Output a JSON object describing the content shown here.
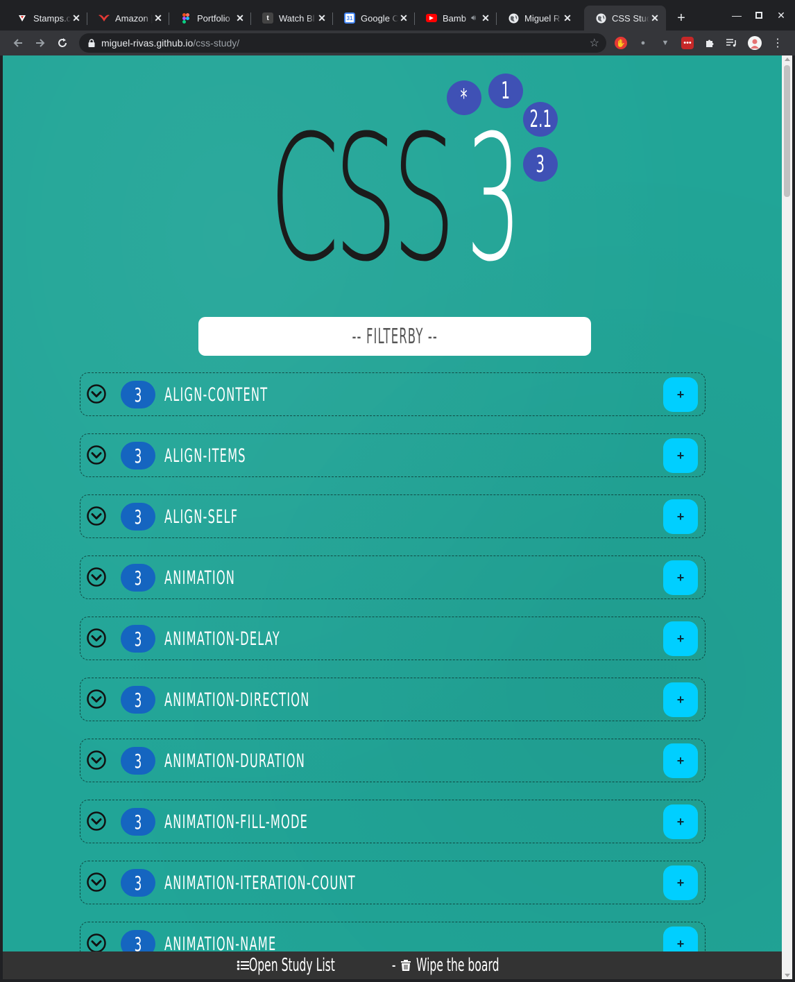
{
  "browser": {
    "tabs": [
      {
        "title": "Stamps.c",
        "favicon": "stamps-icon",
        "color": "#ffffff"
      },
      {
        "title": "Amazon |",
        "favicon": "amazon-bird-icon",
        "color": "#e53935"
      },
      {
        "title": "Portfolio",
        "favicon": "figma-icon",
        "color": "#f24e1e"
      },
      {
        "title": "Watch Bl",
        "favicon": "tumblr-icon",
        "color": "#444444"
      },
      {
        "title": "Google C",
        "favicon": "calendar-icon",
        "color": "#4285f4"
      },
      {
        "title": "Bamb",
        "favicon": "youtube-icon",
        "color": "#ff0000"
      },
      {
        "title": "Miguel R",
        "favicon": "globe-icon",
        "color": "#9aa0a6"
      },
      {
        "title": "CSS Stud",
        "favicon": "globe-icon",
        "color": "#9aa0a6",
        "active": true
      }
    ],
    "new_tab_label": "+",
    "address": {
      "host": "miguel-rivas.github.io",
      "path": "/css-study/"
    }
  },
  "hero": {
    "title": "CSS",
    "version": "3",
    "version_bubbles": [
      "*",
      "1",
      "2.1",
      "3"
    ]
  },
  "filter": {
    "label": "-- FILTERBY --"
  },
  "properties": [
    {
      "version": "3",
      "name": "ALIGN-CONTENT"
    },
    {
      "version": "3",
      "name": "ALIGN-ITEMS"
    },
    {
      "version": "3",
      "name": "ALIGN-SELF"
    },
    {
      "version": "3",
      "name": "ANIMATION"
    },
    {
      "version": "3",
      "name": "ANIMATION-DELAY"
    },
    {
      "version": "3",
      "name": "ANIMATION-DIRECTION"
    },
    {
      "version": "3",
      "name": "ANIMATION-DURATION"
    },
    {
      "version": "3",
      "name": "ANIMATION-FILL-MODE"
    },
    {
      "version": "3",
      "name": "ANIMATION-ITERATION-COUNT"
    },
    {
      "version": "3",
      "name": "ANIMATION-NAME"
    }
  ],
  "row_add_label": "+",
  "bottom_bar": {
    "open_label": "Open Study List",
    "separator": "-",
    "wipe_label": "Wipe the board"
  },
  "colors": {
    "background": "#21a597",
    "version_bubble": "#3f51b5",
    "badge": "#1565c0",
    "add_button": "#00cfff"
  }
}
